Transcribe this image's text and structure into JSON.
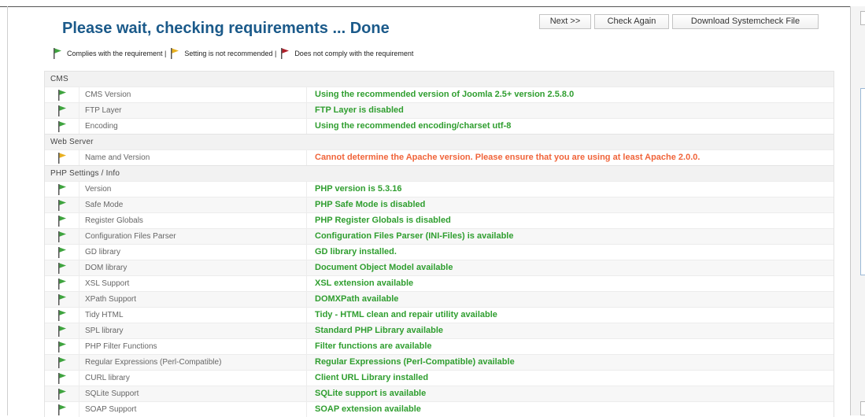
{
  "title": "Please wait, checking requirements ... Done",
  "toolbar": {
    "next_label": "Next >>",
    "check_again_label": "Check Again",
    "download_label": "Download Systemcheck File"
  },
  "legend": [
    {
      "status": "ok",
      "text": "Complies with the requirement |"
    },
    {
      "status": "warn",
      "text": "Setting is not recommended |"
    },
    {
      "status": "fail",
      "text": "Does not comply with the requirement"
    }
  ],
  "colors": {
    "ok": "#2f9e2f",
    "warn": "#f0643a",
    "flag_ok": "#3fa43f",
    "flag_warn": "#e8b020",
    "flag_fail": "#b0202a",
    "title": "#1b5a8a"
  },
  "sections": [
    {
      "title": "CMS",
      "rows": [
        {
          "status": "ok",
          "name": "CMS Version",
          "message": "Using the recommended version of Joomla 2.5+ version 2.5.8.0"
        },
        {
          "status": "ok",
          "name": "FTP Layer",
          "message": "FTP Layer is disabled"
        },
        {
          "status": "ok",
          "name": "Encoding",
          "message": "Using the recommended encoding/charset utf-8"
        }
      ]
    },
    {
      "title": "Web Server",
      "rows": [
        {
          "status": "warn",
          "name": "Name and Version",
          "message": "Cannot determine the Apache version. Please ensure that you are using at least Apache 2.0.0."
        }
      ]
    },
    {
      "title": "PHP Settings / Info",
      "rows": [
        {
          "status": "ok",
          "name": "Version",
          "message": "PHP version is 5.3.16"
        },
        {
          "status": "ok",
          "name": "Safe Mode",
          "message": "PHP Safe Mode is disabled"
        },
        {
          "status": "ok",
          "name": "Register Globals",
          "message": "PHP Register Globals is disabled"
        },
        {
          "status": "ok",
          "name": "Configuration Files Parser",
          "message": "Configuration Files Parser (INI-Files) is available"
        },
        {
          "status": "ok",
          "name": "GD library",
          "message": "GD library installed."
        },
        {
          "status": "ok",
          "name": "DOM library",
          "message": "Document Object Model available"
        },
        {
          "status": "ok",
          "name": "XSL Support",
          "message": "XSL extension available"
        },
        {
          "status": "ok",
          "name": "XPath Support",
          "message": "DOMXPath available"
        },
        {
          "status": "ok",
          "name": "Tidy HTML",
          "message": "Tidy - HTML clean and repair utility available"
        },
        {
          "status": "ok",
          "name": "SPL library",
          "message": "Standard PHP Library available"
        },
        {
          "status": "ok",
          "name": "PHP Filter Functions",
          "message": "Filter functions are available"
        },
        {
          "status": "ok",
          "name": "Regular Expressions (Perl-Compatible)",
          "message": "Regular Expressions (Perl-Compatible) available"
        },
        {
          "status": "ok",
          "name": "CURL library",
          "message": "Client URL Library installed"
        },
        {
          "status": "ok",
          "name": "SQLite Support",
          "message": "SQLite support is available"
        },
        {
          "status": "ok",
          "name": "SOAP Support",
          "message": "SOAP extension available"
        }
      ]
    }
  ]
}
